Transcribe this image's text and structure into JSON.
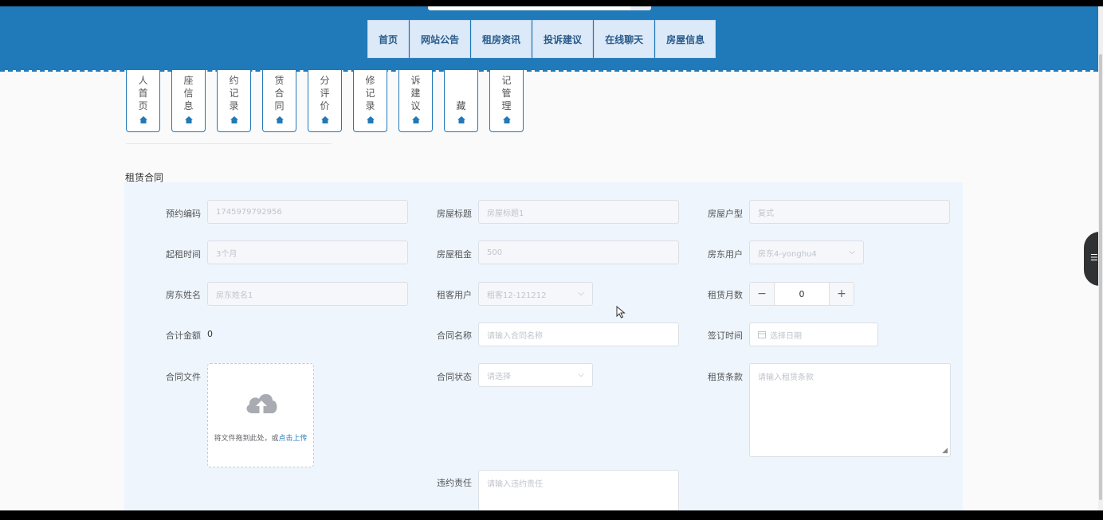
{
  "nav": {
    "items": [
      "首页",
      "网站公告",
      "租房资讯",
      "投诉建议",
      "在线聊天",
      "房屋信息"
    ]
  },
  "tiles": [
    {
      "lines": [
        "人",
        "首",
        "页"
      ]
    },
    {
      "lines": [
        "座",
        "信",
        "息"
      ]
    },
    {
      "lines": [
        "约",
        "记",
        "录"
      ]
    },
    {
      "lines": [
        "赁",
        "合",
        "同"
      ]
    },
    {
      "lines": [
        "分",
        "评",
        "价"
      ]
    },
    {
      "lines": [
        "修",
        "记",
        "录"
      ]
    },
    {
      "lines": [
        "诉",
        "建",
        "议"
      ]
    },
    {
      "lines": [
        "藏"
      ]
    },
    {
      "lines": [
        "记",
        "管",
        "理"
      ]
    }
  ],
  "section": {
    "title": "租赁合同"
  },
  "form": {
    "booking_code": {
      "label": "预约编码",
      "value": "1745979792956"
    },
    "house_title": {
      "label": "房屋标题",
      "value": "房屋标题1"
    },
    "house_type": {
      "label": "房屋户型",
      "value": "复式"
    },
    "rent_period": {
      "label": "起租时间",
      "value": "3个月"
    },
    "house_rent": {
      "label": "房屋租金",
      "value": "500"
    },
    "landlord_user": {
      "label": "房东用户",
      "value": "房东4-yonghu4"
    },
    "landlord_name": {
      "label": "房东姓名",
      "value": "房东姓名1"
    },
    "tenant_user": {
      "label": "租客用户",
      "value": "租客12-121212"
    },
    "lease_months": {
      "label": "租赁月数",
      "value": "0",
      "minus": "−",
      "plus": "+"
    },
    "total_amount": {
      "label": "合计金额",
      "value": "0"
    },
    "contract_name": {
      "label": "合同名称",
      "placeholder": "请输入合同名称"
    },
    "sign_time": {
      "label": "签订时间",
      "placeholder": "选择日期"
    },
    "contract_file": {
      "label": "合同文件",
      "upload_text": "将文件拖到此处，或",
      "upload_link": "点击上传"
    },
    "contract_status": {
      "label": "合同状态",
      "placeholder": "请选择"
    },
    "lease_terms": {
      "label": "租赁条款",
      "placeholder": "请输入租赁条款"
    },
    "breach_liability": {
      "label": "违约责任",
      "placeholder": "请输入违约责任"
    }
  },
  "colors": {
    "header": "#2079b8",
    "panel": "#eef5fd",
    "link": "#2079b8"
  },
  "icons": {
    "tile": "home-icon",
    "upload": "cloud-upload-icon",
    "date": "calendar-icon",
    "side": "menu-icon"
  }
}
